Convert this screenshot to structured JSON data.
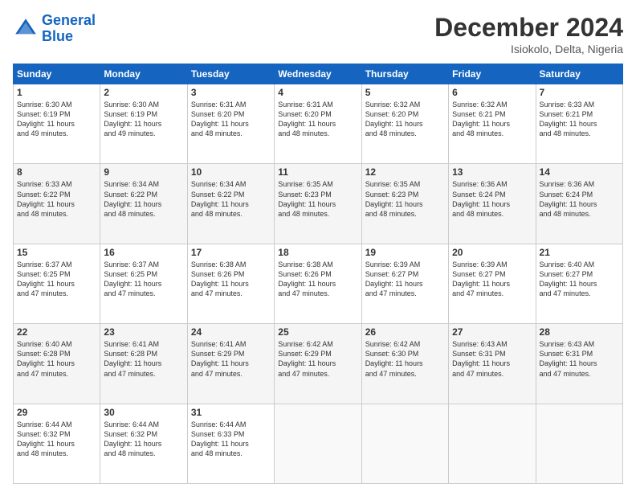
{
  "header": {
    "logo_general": "General",
    "logo_blue": "Blue",
    "month_title": "December 2024",
    "location": "Isiokolo, Delta, Nigeria"
  },
  "weekdays": [
    "Sunday",
    "Monday",
    "Tuesday",
    "Wednesday",
    "Thursday",
    "Friday",
    "Saturday"
  ],
  "weeks": [
    [
      {
        "day": "1",
        "sunrise": "6:30 AM",
        "sunset": "6:19 PM",
        "daylight": "11 hours and 49 minutes."
      },
      {
        "day": "2",
        "sunrise": "6:30 AM",
        "sunset": "6:19 PM",
        "daylight": "11 hours and 49 minutes."
      },
      {
        "day": "3",
        "sunrise": "6:31 AM",
        "sunset": "6:20 PM",
        "daylight": "11 hours and 48 minutes."
      },
      {
        "day": "4",
        "sunrise": "6:31 AM",
        "sunset": "6:20 PM",
        "daylight": "11 hours and 48 minutes."
      },
      {
        "day": "5",
        "sunrise": "6:32 AM",
        "sunset": "6:20 PM",
        "daylight": "11 hours and 48 minutes."
      },
      {
        "day": "6",
        "sunrise": "6:32 AM",
        "sunset": "6:21 PM",
        "daylight": "11 hours and 48 minutes."
      },
      {
        "day": "7",
        "sunrise": "6:33 AM",
        "sunset": "6:21 PM",
        "daylight": "11 hours and 48 minutes."
      }
    ],
    [
      {
        "day": "8",
        "sunrise": "6:33 AM",
        "sunset": "6:22 PM",
        "daylight": "11 hours and 48 minutes."
      },
      {
        "day": "9",
        "sunrise": "6:34 AM",
        "sunset": "6:22 PM",
        "daylight": "11 hours and 48 minutes."
      },
      {
        "day": "10",
        "sunrise": "6:34 AM",
        "sunset": "6:22 PM",
        "daylight": "11 hours and 48 minutes."
      },
      {
        "day": "11",
        "sunrise": "6:35 AM",
        "sunset": "6:23 PM",
        "daylight": "11 hours and 48 minutes."
      },
      {
        "day": "12",
        "sunrise": "6:35 AM",
        "sunset": "6:23 PM",
        "daylight": "11 hours and 48 minutes."
      },
      {
        "day": "13",
        "sunrise": "6:36 AM",
        "sunset": "6:24 PM",
        "daylight": "11 hours and 48 minutes."
      },
      {
        "day": "14",
        "sunrise": "6:36 AM",
        "sunset": "6:24 PM",
        "daylight": "11 hours and 48 minutes."
      }
    ],
    [
      {
        "day": "15",
        "sunrise": "6:37 AM",
        "sunset": "6:25 PM",
        "daylight": "11 hours and 47 minutes."
      },
      {
        "day": "16",
        "sunrise": "6:37 AM",
        "sunset": "6:25 PM",
        "daylight": "11 hours and 47 minutes."
      },
      {
        "day": "17",
        "sunrise": "6:38 AM",
        "sunset": "6:26 PM",
        "daylight": "11 hours and 47 minutes."
      },
      {
        "day": "18",
        "sunrise": "6:38 AM",
        "sunset": "6:26 PM",
        "daylight": "11 hours and 47 minutes."
      },
      {
        "day": "19",
        "sunrise": "6:39 AM",
        "sunset": "6:27 PM",
        "daylight": "11 hours and 47 minutes."
      },
      {
        "day": "20",
        "sunrise": "6:39 AM",
        "sunset": "6:27 PM",
        "daylight": "11 hours and 47 minutes."
      },
      {
        "day": "21",
        "sunrise": "6:40 AM",
        "sunset": "6:27 PM",
        "daylight": "11 hours and 47 minutes."
      }
    ],
    [
      {
        "day": "22",
        "sunrise": "6:40 AM",
        "sunset": "6:28 PM",
        "daylight": "11 hours and 47 minutes."
      },
      {
        "day": "23",
        "sunrise": "6:41 AM",
        "sunset": "6:28 PM",
        "daylight": "11 hours and 47 minutes."
      },
      {
        "day": "24",
        "sunrise": "6:41 AM",
        "sunset": "6:29 PM",
        "daylight": "11 hours and 47 minutes."
      },
      {
        "day": "25",
        "sunrise": "6:42 AM",
        "sunset": "6:29 PM",
        "daylight": "11 hours and 47 minutes."
      },
      {
        "day": "26",
        "sunrise": "6:42 AM",
        "sunset": "6:30 PM",
        "daylight": "11 hours and 47 minutes."
      },
      {
        "day": "27",
        "sunrise": "6:43 AM",
        "sunset": "6:31 PM",
        "daylight": "11 hours and 47 minutes."
      },
      {
        "day": "28",
        "sunrise": "6:43 AM",
        "sunset": "6:31 PM",
        "daylight": "11 hours and 47 minutes."
      }
    ],
    [
      {
        "day": "29",
        "sunrise": "6:44 AM",
        "sunset": "6:32 PM",
        "daylight": "11 hours and 48 minutes."
      },
      {
        "day": "30",
        "sunrise": "6:44 AM",
        "sunset": "6:32 PM",
        "daylight": "11 hours and 48 minutes."
      },
      {
        "day": "31",
        "sunrise": "6:44 AM",
        "sunset": "6:33 PM",
        "daylight": "11 hours and 48 minutes."
      },
      null,
      null,
      null,
      null
    ]
  ]
}
